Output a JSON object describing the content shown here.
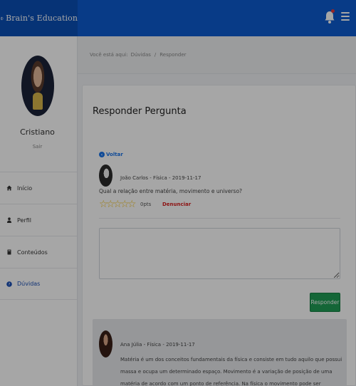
{
  "header": {
    "brand": "Brain's Education",
    "icons": {
      "logo": "brain-logo-icon",
      "notifications": "bell-icon",
      "menu": "hamburger-icon"
    },
    "colors": {
      "topbar": "#0d5bcf",
      "brand_bg": "#0a4fb6",
      "badge": "#e83a3a"
    }
  },
  "sidebar": {
    "user_name": "Cristiano",
    "logout_label": "Sair",
    "items": [
      {
        "label": "Início",
        "icon": "home-icon"
      },
      {
        "label": "Perfil",
        "icon": "user-icon"
      },
      {
        "label": "Conteúdos",
        "icon": "book-icon"
      },
      {
        "label": "Dúvidas",
        "icon": "question-circle-icon",
        "active": true
      }
    ]
  },
  "breadcrumb": {
    "prefix": "Você está aqui:",
    "items": [
      "Dúvidas",
      "Responder"
    ],
    "separator": "/"
  },
  "main": {
    "title": "Responder Pergunta",
    "back_label": "Voltar",
    "question": {
      "meta": "João Carlos - Física - 2019-11-17",
      "text": "Qual a relação entre matéria, movimento e universo?",
      "rating": 0,
      "max_rating": 5,
      "points": "0pts",
      "report_label": "Denunciar"
    },
    "answer_input": {
      "value": "",
      "placeholder": ""
    },
    "reply_button": "Responder",
    "colors": {
      "reply": "#1f9d55",
      "report": "#d92020",
      "link": "#1a73e8"
    }
  },
  "answers": [
    {
      "meta": "Ana Júlia - Física - 2019-11-17",
      "text": "Matéria é um dos conceitos fundamentais da física e consiste em tudo aquilo que possui massa e ocupa um determinado espaço. Movimento é a variação de posição de uma matéria de acordo com um ponto de referência. Na física o movimento pode ser classificado como retilíneo uniforme"
    }
  ]
}
